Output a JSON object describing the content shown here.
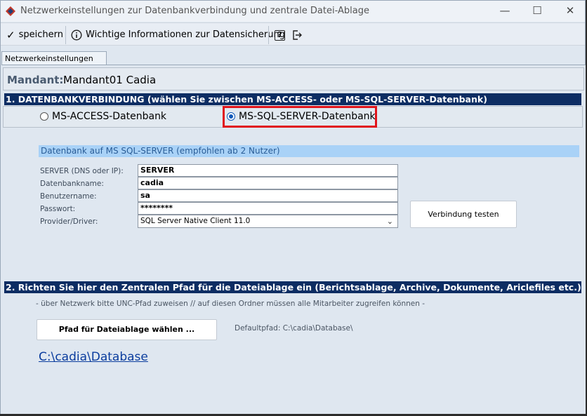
{
  "window": {
    "title": "Netzwerkeinstellungen zur Datenbankverbindung und zentrale Datei-Ablage",
    "controls": {
      "minimize": "—",
      "maximize": "☐",
      "close": "✕"
    }
  },
  "toolbar": {
    "save_label": "speichern",
    "info_label": "Wichtige Informationen zur Datensicherung",
    "help_icon": "?"
  },
  "tabs": [
    {
      "label": "Netzwerkeinstellungen"
    }
  ],
  "mandant": {
    "label": "Mandant:",
    "value": "Mandant01 Cadia"
  },
  "section1": {
    "title": "1. DATENBANKVERBINDUNG (wählen Sie zwischen MS-ACCESS- oder MS-SQL-SERVER-Datenbank)",
    "options": [
      {
        "label": "MS-ACCESS-Datenbank",
        "checked": false
      },
      {
        "label": "MS-SQL-SERVER-Datenbank",
        "checked": true
      }
    ]
  },
  "sql": {
    "header": "Datenbank auf MS SQL-SERVER (empfohlen ab 2 Nutzer)",
    "fields": [
      {
        "label": "SERVER (DNS oder IP):",
        "value": "SERVER"
      },
      {
        "label": "Datenbankname:",
        "value": "cadia"
      },
      {
        "label": "Benutzername:",
        "value": "sa"
      },
      {
        "label": "Passwort:",
        "value": "********"
      }
    ],
    "provider_label": "Provider/Driver:",
    "provider_value": "SQL Server Native Client 11.0",
    "test_button": "Verbindung testen"
  },
  "section2": {
    "title": "2. Richten Sie hier den Zentralen Pfad für die Dateiablage ein (Berichtsablage, Archive, Dokumente, Ariclefiles etc.)",
    "hint": "- über Netzwerk bitte UNC-Pfad zuweisen // auf diesen Ordner müssen alle Mitarbeiter zugreifen können -",
    "choose_button": "Pfad für Dateiablage wählen ...",
    "default_path": "Defaultpfad: C:\\cadia\\Database\\",
    "path_link": "C:\\cadia\\Database"
  },
  "colors": {
    "section_header_bg": "#0d2d63",
    "sub_header_bg": "#a9d2f7",
    "highlight": "#e0141b",
    "link": "#0b3d9e"
  }
}
